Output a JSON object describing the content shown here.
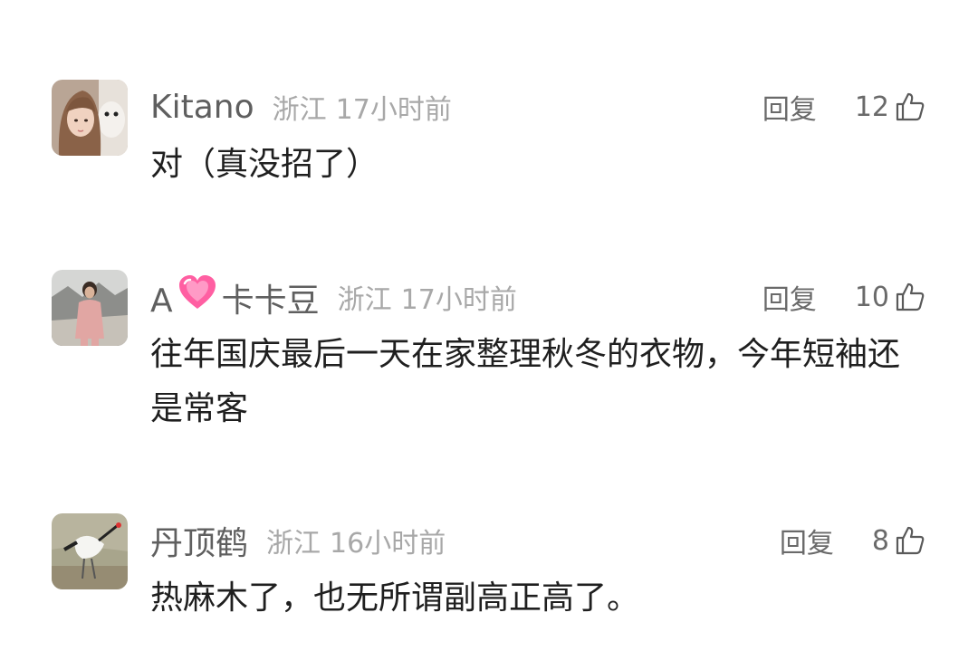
{
  "comments": [
    {
      "username": "Kitano",
      "location": "浙江",
      "time": "17小时前",
      "reply_label": "回复",
      "likes": "12",
      "text": "对（真没招了）",
      "avatar": "girl-with-plush-photo"
    },
    {
      "username_prefix": "A",
      "username_emoji": "pink-sparkling-heart-icon",
      "username_suffix": "卡卡豆",
      "location": "浙江",
      "time": "17小时前",
      "reply_label": "回复",
      "likes": "10",
      "text": "往年国庆最后一天在家整理秋冬的衣物，今年短袖还是常客",
      "avatar": "person-in-pink-outfit-photo"
    },
    {
      "username": "丹顶鹤",
      "location": "浙江",
      "time": "16小时前",
      "reply_label": "回复",
      "likes": "8",
      "text": "热麻木了，也无所谓副高正高了。",
      "avatar": "red-crowned-crane-photo"
    }
  ],
  "colors": {
    "username": "#5f5f5f",
    "meta": "#a8a8a8",
    "action": "#6a6a6a",
    "text": "#1f1f1f",
    "heart": "#ff5fa2"
  }
}
